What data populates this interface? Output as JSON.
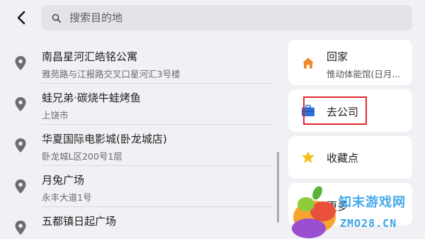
{
  "search": {
    "placeholder": "搜索目的地"
  },
  "results": [
    {
      "name": "南昌星河汇皓铭公寓",
      "address": "雅苑路与江报路交叉口星河汇3号楼"
    },
    {
      "name": "蛙兄弟·碳烧牛蛙烤鱼",
      "address": "上饶市"
    },
    {
      "name": "华夏国际电影城(卧龙城店)",
      "address": "卧龙城L区200号1层"
    },
    {
      "name": "月兔广场",
      "address": "永丰大道1号"
    },
    {
      "name": "五都镇日起广场",
      "address": ""
    }
  ],
  "shortcuts": {
    "home": {
      "label": "回家",
      "subtitle": "惟动体能馆(日月..."
    },
    "company": {
      "label": "去公司"
    },
    "favorites": {
      "label": "收藏点"
    },
    "more": {
      "label": "更多"
    }
  },
  "watermark": {
    "site_name": "知末游戏网",
    "url": "ZMO28.CN"
  },
  "colors": {
    "home_icon": "#f08a2a",
    "company_icon": "#2f6fd8",
    "star_icon": "#f4c21a",
    "highlight": "#e0262b"
  }
}
